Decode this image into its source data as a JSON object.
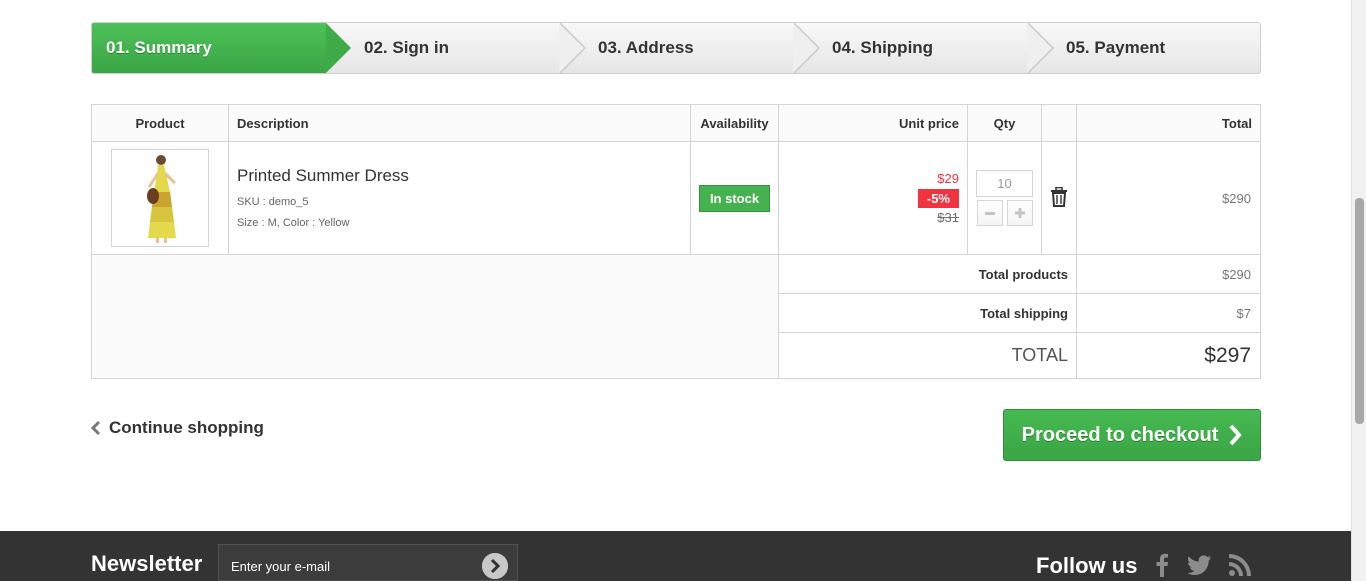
{
  "steps": [
    {
      "label": "01. Summary"
    },
    {
      "label": "02. Sign in"
    },
    {
      "label": "03. Address"
    },
    {
      "label": "04. Shipping"
    },
    {
      "label": "05. Payment"
    }
  ],
  "table": {
    "headers": {
      "product": "Product",
      "description": "Description",
      "availability": "Availability",
      "unit_price": "Unit price",
      "qty": "Qty",
      "total": "Total"
    },
    "item": {
      "name": "Printed Summer Dress",
      "sku": "SKU : demo_5",
      "attributes": "Size : M, Color : Yellow",
      "availability": "In stock",
      "price_new": "$29",
      "discount": "-5%",
      "price_old": "$31",
      "qty": "10",
      "total": "$290"
    },
    "summary": {
      "total_products_label": "Total products",
      "total_products_value": "$290",
      "total_shipping_label": "Total shipping",
      "total_shipping_value": "$7",
      "total_label": "TOTAL",
      "total_value": "$297"
    }
  },
  "actions": {
    "continue_label": "Continue shopping",
    "checkout_label": "Proceed to checkout"
  },
  "footer": {
    "newsletter_title": "Newsletter",
    "newsletter_placeholder": "Enter your e-mail",
    "follow_title": "Follow us"
  },
  "colors": {
    "accent_green": "#46b14f",
    "discount_red": "#f13340",
    "footer_bg": "#333333"
  },
  "icons": [
    "trash-icon",
    "chevron-left-icon",
    "chevron-right-icon",
    "facebook-icon",
    "twitter-icon",
    "rss-icon",
    "arrow-circle-icon"
  ]
}
